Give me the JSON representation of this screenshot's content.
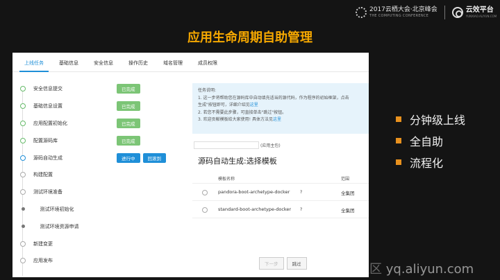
{
  "header": {
    "conference_title": "2017云栖大会·北京峰会",
    "conference_sub": "THE COMPUTING CONFERENCE",
    "brand_title": "云效平台",
    "brand_sub": "YUNXIAO.ALIYUN.COM"
  },
  "slide_title": "应用生命周期自助管理",
  "tabs": [
    {
      "label": "上线任务",
      "active": true
    },
    {
      "label": "基础信息",
      "active": false
    },
    {
      "label": "安全信息",
      "active": false
    },
    {
      "label": "操作历史",
      "active": false
    },
    {
      "label": "域名管理",
      "active": false
    },
    {
      "label": "成员权限",
      "active": false
    }
  ],
  "steps": [
    {
      "label": "安全信息提交",
      "status": "已完成"
    },
    {
      "label": "基础信息设置",
      "status": "已完成"
    },
    {
      "label": "应用配置初始化",
      "status": "已完成"
    },
    {
      "label": "配置源码库",
      "status": "已完成"
    },
    {
      "label": "源码自动生成",
      "status": "进行中",
      "action": "回滚到"
    },
    {
      "label": "构建配置"
    },
    {
      "label": "测试环境准备"
    },
    {
      "label": "测试环境初始化"
    },
    {
      "label": "测试环境资源申请"
    },
    {
      "label": "新建变更"
    },
    {
      "label": "应用发布"
    }
  ],
  "info": {
    "heading": "任务说明:",
    "line1": "1. 这一步将帮助您在源码库中自动填充适当的源代码，作为程序的初始框架，点击",
    "line2": "生成\"按钮即可，详细介绍见",
    "line2_link": "这里",
    "line3": "2. 若您不需要此步骤，可直接单击\"跳过\"按钮。",
    "line4": "3. 欢迎贡献模板给大家使用! 具体方法见",
    "line4_link": "这里"
  },
  "branch_hint": "(应用主包)",
  "section_title": "源码自动生成:选择模板",
  "table": {
    "col_name": "模板名称",
    "col_scope": "范围",
    "rows": [
      {
        "name": "pandora-boot-archetype-docker",
        "q": "?",
        "scope": "全集团"
      },
      {
        "name": "standard-boot-archetype-docker",
        "q": "?",
        "scope": "全集团"
      }
    ]
  },
  "buttons": {
    "next": "下一步",
    "skip": "跳过"
  },
  "bullets": [
    "分钟级上线",
    "全自助",
    "流程化"
  ],
  "watermark": {
    "cn": "云栖社区",
    "url": "yq.aliyun.com"
  },
  "colors": {
    "accent": "#f6a800",
    "blue": "#1f8fd8",
    "green": "#7cc576",
    "bullet": "#e8911e"
  }
}
